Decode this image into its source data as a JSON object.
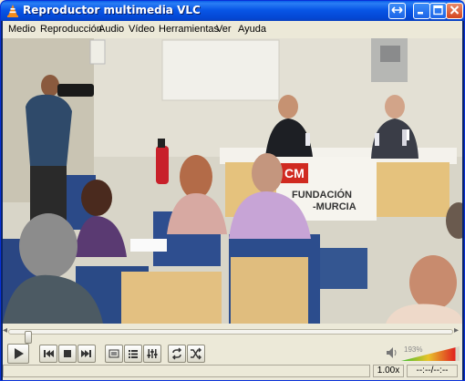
{
  "window": {
    "title": "Reproductor multimedia VLC",
    "icon": "vlc-cone-icon"
  },
  "titlebar_buttons": [
    "restore-swap-icon",
    "minimize-icon",
    "maximize-icon",
    "close-icon"
  ],
  "menu": [
    "Medio",
    "Reproducción",
    "Audio",
    "Vídeo",
    "Herramientas",
    "Ver",
    "Ayuda"
  ],
  "video": {
    "banner_text": "FUNDACIÓN",
    "banner_text2": "-MURCIA",
    "logo_text": "CM"
  },
  "playback": {
    "progress": 0.035,
    "volume_percent_label": "193%",
    "volume_level": 0.93,
    "speed": "1.00x",
    "time": "--:--/--:--"
  },
  "colors": {
    "titlebar": "#0a5fe8",
    "menu_bg": "#ece9d8",
    "volume_start": "#3fbf2f",
    "volume_end": "#e02020"
  }
}
